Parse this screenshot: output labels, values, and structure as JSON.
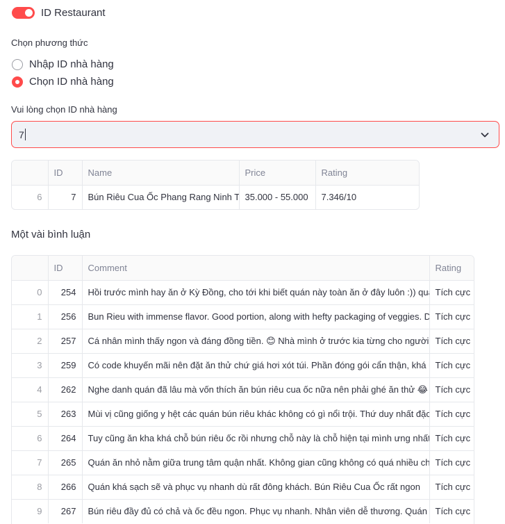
{
  "toggle": {
    "label": "ID Restaurant",
    "on": true
  },
  "method": {
    "title": "Chọn phương thức",
    "options": [
      "Nhập ID nhà hàng",
      "Chọn ID nhà hàng"
    ],
    "selected_index": 1
  },
  "select": {
    "title": "Vui lòng chọn ID nhà hàng",
    "value": "7"
  },
  "restaurant_table": {
    "headers": [
      "",
      "ID",
      "Name",
      "Price",
      "Rating"
    ],
    "rows": [
      {
        "index": "6",
        "id": "7",
        "name": "Bún Riêu Cua Ốc Phang Rang Ninh Th",
        "price": "35.000 - 55.000",
        "rating": "7.346/10"
      }
    ]
  },
  "comments_section": {
    "title": "Một vài bình luận"
  },
  "comments_table": {
    "headers": [
      "",
      "ID",
      "Comment",
      "Rating"
    ],
    "rows": [
      {
        "index": "0",
        "id": "254",
        "comment": "Hồi trước mình hay ăn ở Kỳ Đồng, cho tới khi biết quán này toàn ăn ở đây luôn :)) quá",
        "rating": "Tích cực"
      },
      {
        "index": "1",
        "id": "256",
        "comment": "Bun Rieu with immense flavor. Good portion, along with hefty packaging of veggies. D",
        "rating": "Tích cực"
      },
      {
        "index": "2",
        "id": "257",
        "comment": "Cá nhân mình thấy ngon và đáng đồng tiền. 😊 Nhà mình ở trước kia từng cho người",
        "rating": "Tích cực"
      },
      {
        "index": "3",
        "id": "259",
        "comment": "Có code khuyến mãi nên đặt ăn thử chứ giá hơi xót túi. Phần đóng gói cẩn thận, khá u",
        "rating": "Tích cực"
      },
      {
        "index": "4",
        "id": "262",
        "comment": "Nghe danh quán đã lâu mà vốn thích ăn bún riêu cua ốc nữa nên phải ghé ăn thử 😂",
        "rating": "Tích cực"
      },
      {
        "index": "5",
        "id": "263",
        "comment": "Mùi vị cũng giống y hệt các quán bún riêu khác không có gì nổi trội. Thứ duy nhất đặc",
        "rating": "Tích cực"
      },
      {
        "index": "6",
        "id": "264",
        "comment": "Tuy cũng ăn kha khá chỗ bún riêu ốc rồi nhưng chỗ này là chỗ hiện tại mình ưng nhất",
        "rating": "Tích cực"
      },
      {
        "index": "7",
        "id": "265",
        "comment": "Quán ăn nhỏ nằm giữa trung tâm quận nhất. Không gian cũng không có quá nhiều ch",
        "rating": "Tích cực"
      },
      {
        "index": "8",
        "id": "266",
        "comment": "Quán khá sạch sẽ và phục vụ nhanh dù rất đông khách. Bún Riêu Cua Ốc rất ngon",
        "rating": "Tích cực"
      },
      {
        "index": "9",
        "id": "267",
        "comment": "Bún riêu đầy đủ có chả và ốc đều ngon. Phục vụ nhanh. Nhân viên dễ thương. Quán n",
        "rating": "Tích cực"
      }
    ]
  },
  "colors": {
    "accent": "#ff4b4b",
    "input_bg": "#f0f2f6",
    "border": "#e6e8ec",
    "header_text": "#808495"
  },
  "icons": {
    "select_arrow": "chevron-down-icon"
  }
}
